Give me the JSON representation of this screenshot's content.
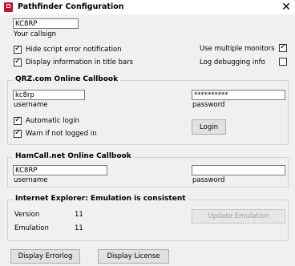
{
  "window": {
    "title": "Pathfinder Configuration",
    "close_glyph": "✕"
  },
  "callsign": {
    "value": "KC8RP",
    "label": "Your callsign"
  },
  "options": {
    "hide_script_errors": {
      "label": "Hide script error notification",
      "checked": true
    },
    "display_title_bars": {
      "label": "Display information in title bars",
      "checked": true
    },
    "multiple_monitors": {
      "label": "Use multiple monitors",
      "checked": true
    },
    "log_debugging": {
      "label": "Log debugging info",
      "checked": false
    }
  },
  "qrz": {
    "legend": "QRZ.com Online Callbook",
    "username_value": "kc8rp",
    "username_label": "username",
    "password_value": "**********",
    "password_label": "password",
    "auto_login": {
      "label": "Automatic login",
      "checked": true
    },
    "warn_not_logged": {
      "label": "Warn if not logged in",
      "checked": true
    },
    "login_button": "Login"
  },
  "hamcall": {
    "legend": "HamCall.net Online Callbook",
    "username_value": "KC8RP",
    "username_label": "username",
    "password_value": "",
    "password_label": "password"
  },
  "ie": {
    "legend": "Internet Explorer: Emulation is consistent",
    "version_label": "Version",
    "version_value": "11",
    "emulation_label": "Emulation",
    "emulation_value": "11",
    "update_button": "Update Emulation"
  },
  "footer": {
    "errorlog_button": "Display Errorlog",
    "license_button": "Display License"
  }
}
